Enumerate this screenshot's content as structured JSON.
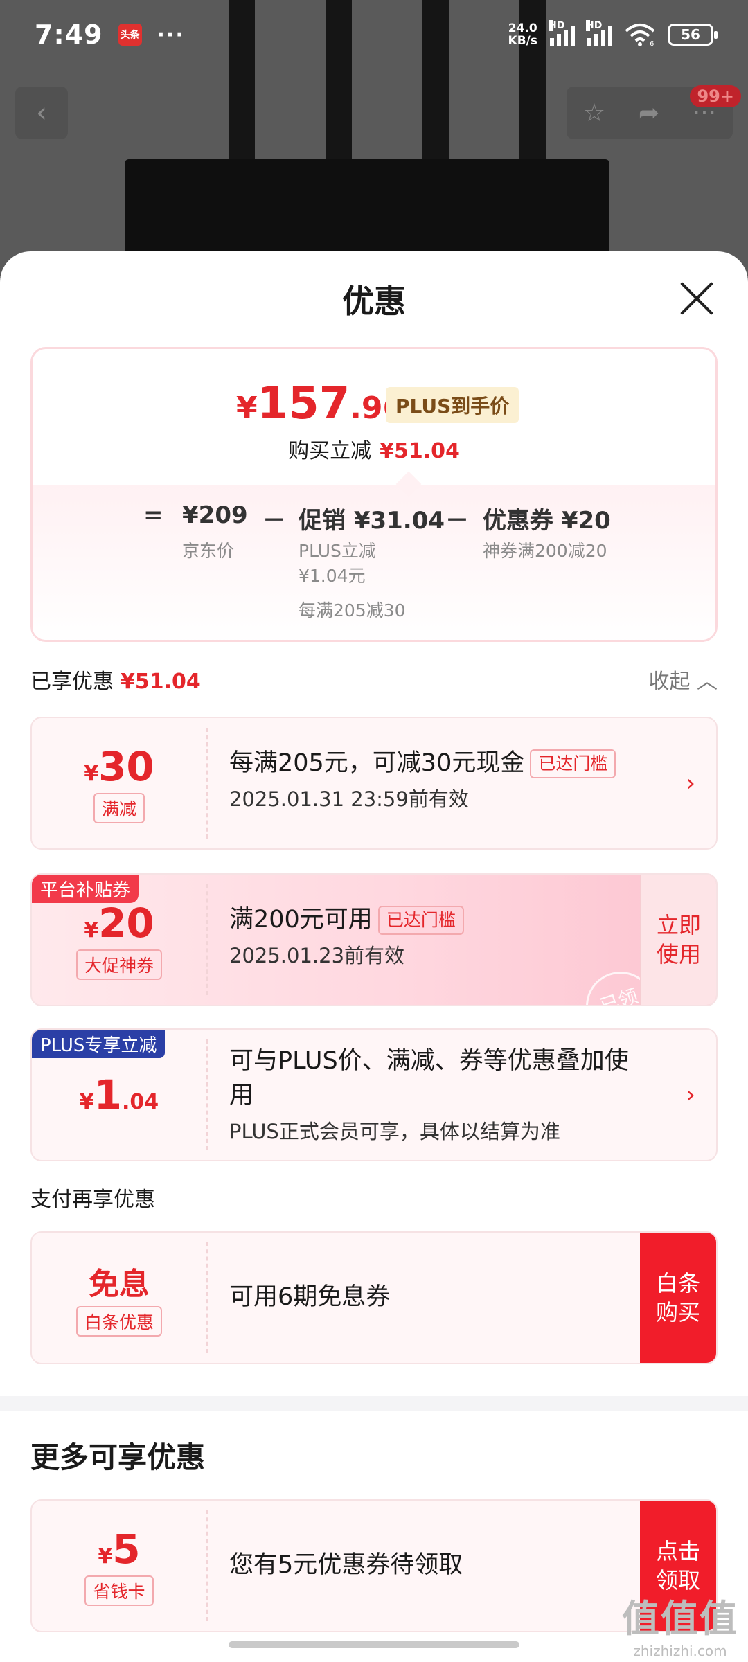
{
  "status_bar": {
    "time": "7:49",
    "app_badge": "头条",
    "dots": "···",
    "net_speed_value": "24.0",
    "net_speed_unit": "KB/s",
    "sig1_label": "HD",
    "sig2_label": "HD",
    "wifi_label": "6",
    "battery": "56"
  },
  "nav": {
    "badge": "99+"
  },
  "sheet": {
    "title": "优惠",
    "final_price": {
      "currency": "¥",
      "integer": "157",
      "decimal": ".96"
    },
    "plus_tag": "PLUS到手价",
    "save_label": "购买立减",
    "save_amount": "¥51.04",
    "breakdown": {
      "eq": "=",
      "jd_price": "¥209",
      "jd_label": "京东价",
      "minus1": "－",
      "promo": "促销 ¥31.04",
      "promo_sub1": "PLUS立减",
      "promo_sub2": "¥1.04元",
      "promo_sub3": "每满205减30",
      "minus2": "－",
      "coupon": "优惠券 ¥20",
      "coupon_sub": "神券满200减20"
    },
    "enjoyed_label": "已享优惠",
    "enjoyed_amount": "¥51.04",
    "collapse_label": "收起",
    "coupons": [
      {
        "currency": "¥",
        "amount": "30",
        "decimal": "",
        "tag": "满减",
        "title": "每满205元，可减30元现金",
        "reached": "已达门槛",
        "sub": "2025.01.31 23:59前有效"
      },
      {
        "corner": "平台补贴券",
        "currency": "¥",
        "amount": "20",
        "decimal": "",
        "tag": "大促神券",
        "title": "满200元可用",
        "reached": "已达门槛",
        "sub": "2025.01.23前有效",
        "action": "立即\n使用",
        "stamp": "已领"
      },
      {
        "corner": "PLUS专享立减",
        "currency": "¥",
        "amount": "1",
        "decimal": ".04",
        "title": "可与PLUS价、满减、券等优惠叠加使用",
        "sub": "PLUS正式会员可享，具体以结算为准"
      }
    ],
    "pay_section_label": "支付再享优惠",
    "pay_coupon": {
      "big": "免息",
      "tag": "白条优惠",
      "title": "可用6期免息券",
      "action": "白条\n购买"
    },
    "more_title": "更多可享优惠",
    "more_coupon": {
      "currency": "¥",
      "amount": "5",
      "tag": "省钱卡",
      "title": "您有5元优惠券待领取",
      "action": "点击\n领取"
    }
  },
  "watermark": {
    "big": "值值值",
    "small": "zhizhizhi.com"
  },
  "colors": {
    "accent": "#e4262b",
    "action_red": "#f11d2a",
    "plus_blue": "#2b3fa6"
  }
}
